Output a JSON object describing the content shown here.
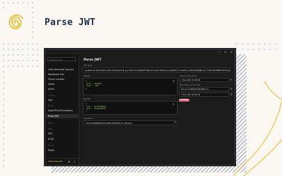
{
  "hero": {
    "title": "Parse JWT"
  },
  "window": {
    "controls": [
      "—",
      "☐",
      "✕"
    ]
  },
  "sidebar": {
    "search_placeholder": "Search tools",
    "items_top": [
      "Latin Generate (ipsum)",
      "Wordhead info",
      "Phone number",
      "Insert",
      "Quick"
    ],
    "categories": [
      "Viewer",
      "Date",
      "Math",
      "Web",
      "Magic"
    ],
    "cat_items": {
      "viewer": "Text",
      "date": "Date/Time/Timestamp",
      "web1": "URL",
      "web2": "UUID",
      "magic": "Magic"
    },
    "active_item": "Parse JWT",
    "footer_label": "DEAR TOGGLER"
  },
  "main": {
    "title": "Parse JWT",
    "jwt_label": "JWT token",
    "jwt_value": "eyJhbGciOiJIUzI1NiIsInR5cCI6IkpXVCJ9.eyJzdWIiOiIxMjM0NTY3ODkwIiwibmFtZSI6IkpvaG4gRG9lIiwiaWF0IjoxNTE2MjM5MDIyfQ.SflKxwRJSMeKKF2QT4fwpMeJf36POk6yJV_adQssw5c",
    "header_label": "Header",
    "header_lines": [
      "{",
      "  \"alg\": \"HS256\",",
      "  \"typ\": \"JWT\"",
      "}"
    ],
    "payload_label": "Payload",
    "payload_lines": [
      "{",
      "  \"iat\": 1516239022,",
      "  \"exp\": 1516239022",
      "}"
    ],
    "signature_label": "Signature",
    "signature_value": "SflKxwRJSMeKKF2QT4fwpMeJf36POk6yJV_adQssw5c",
    "issued_label": "Issued (Unix time)",
    "issued_value": "7 Sep 2021 10:48:38",
    "expires_label": "Not before (Local time)",
    "expires_value": "7 Sep 2021 10:48:38",
    "jti_value": "bdc-ae-sc2f80eb79a0a800c7e",
    "date3_value": "7 Sep 2021 09:43:32",
    "status_badge": "EXPIRED"
  },
  "colors": {
    "accent_yellow": "#e4c349",
    "accent_blue": "#7aa2d6",
    "title_navy": "#1f2f44",
    "badge_pink": "#e26a82"
  }
}
